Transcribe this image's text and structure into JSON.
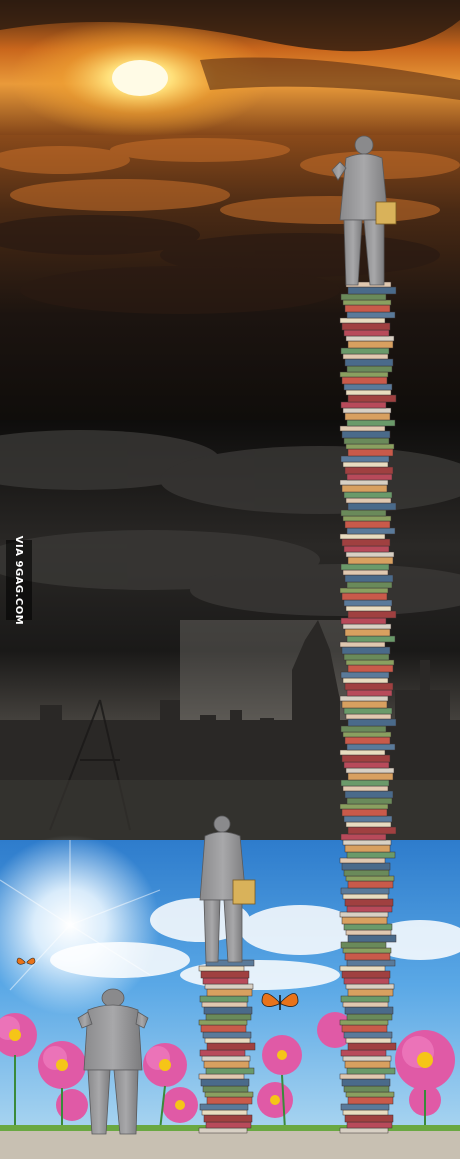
{
  "watermark": {
    "text": "VIA 9GAG.COM"
  },
  "scene": {
    "panels": [
      "sunset-above-clouds",
      "storm-over-ruined-city",
      "painted-wall-with-flowers"
    ],
    "figures": [
      "man-on-tall-book-stack",
      "man-on-short-book-stack",
      "man-at-wall"
    ],
    "colors": {
      "sun": "#fff3b0",
      "sky_orange": "#e07a1e",
      "storm_dark": "#121212",
      "wall_blue": "#3d8fd6",
      "figure_gray": "#9a9a9a",
      "flower_pink": "#e05aa6",
      "butterfly_orange": "#e8731a"
    }
  }
}
